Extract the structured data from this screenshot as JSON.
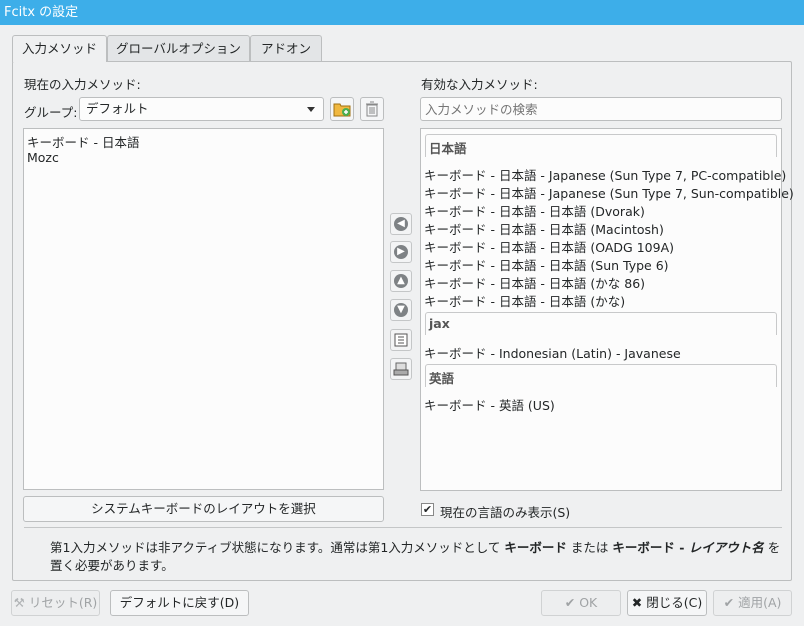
{
  "window": {
    "title": "Fcitx の設定",
    "accent": "#3daee9"
  },
  "tabs": [
    {
      "label": "入力メソッド",
      "active": true
    },
    {
      "label": "グローバルオプション",
      "active": false
    },
    {
      "label": "アドオン",
      "active": false
    }
  ],
  "left": {
    "header": "現在の入力メソッド:",
    "group_label": "グループ:",
    "group_value": "デフォルト",
    "items": [
      "キーボード - 日本語",
      "Mozc"
    ],
    "layout_button": "システムキーボードのレイアウトを選択"
  },
  "right": {
    "header": "有効な入力メソッド:",
    "search_placeholder": "入力メソッドの検索",
    "groups": [
      {
        "name": "日本語",
        "items": [
          "キーボード - 日本語 - Japanese (Sun Type 7, PC-compatible)",
          "キーボード - 日本語 - Japanese (Sun Type 7, Sun-compatible)",
          "キーボード - 日本語 - 日本語 (Dvorak)",
          "キーボード - 日本語 - 日本語 (Macintosh)",
          "キーボード - 日本語 - 日本語 (OADG 109A)",
          "キーボード - 日本語 - 日本語 (Sun Type 6)",
          "キーボード - 日本語 - 日本語 (かな 86)",
          "キーボード - 日本語 - 日本語 (かな)"
        ]
      },
      {
        "name": "jax",
        "items": [
          "キーボード - Indonesian (Latin) - Javanese"
        ]
      },
      {
        "name": "英語",
        "items": [
          "キーボード - 英語 (US)"
        ]
      }
    ],
    "only_current_language": "現在の言語のみ表示(S)"
  },
  "info": {
    "part1": "第1入力メソッドは非アクティブ状態になります。通常は第1入力メソッドとして ",
    "bold1": "キーボード",
    "part2": " または ",
    "bold2": "キーボード - ",
    "bold2_italic": "レイアウト名",
    "part3": " を置く必要があります。"
  },
  "footer": {
    "reset": "リセット(R)",
    "defaults": "デフォルトに戻す(D)",
    "ok": "OK",
    "close": "閉じる(C)",
    "apply": "適用(A)"
  }
}
